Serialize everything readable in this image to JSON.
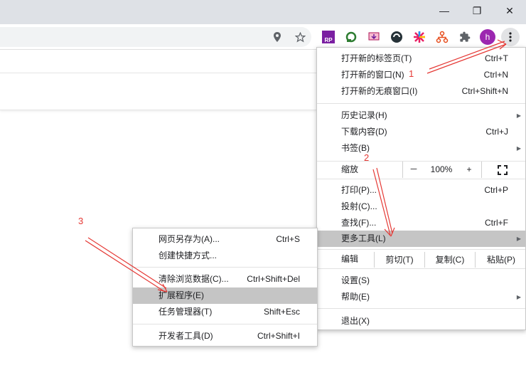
{
  "window_controls": {
    "minimize": "—",
    "restore": "❐",
    "close": "✕"
  },
  "toolbar": {
    "profile_initial": "h",
    "ext_rp_label": "RP",
    "accent_purple": "#9c27b0"
  },
  "main_menu": {
    "new_tab": "打开新的标签页(T)",
    "new_tab_sc": "Ctrl+T",
    "new_window": "打开新的窗口(N)",
    "new_window_sc": "Ctrl+N",
    "incognito": "打开新的无痕窗口(I)",
    "incognito_sc": "Ctrl+Shift+N",
    "history": "历史记录(H)",
    "downloads": "下载内容(D)",
    "downloads_sc": "Ctrl+J",
    "bookmarks": "书签(B)",
    "zoom": "缩放",
    "zoom_minus": "－",
    "zoom_value": "100%",
    "zoom_plus": "+",
    "print": "打印(P)...",
    "print_sc": "Ctrl+P",
    "cast": "投射(C)...",
    "find": "查找(F)...",
    "find_sc": "Ctrl+F",
    "more_tools": "更多工具(L)",
    "edit": "编辑",
    "cut": "剪切(T)",
    "copy": "复制(C)",
    "paste": "粘贴(P)",
    "settings": "设置(S)",
    "help": "帮助(E)",
    "exit": "退出(X)"
  },
  "sub_menu": {
    "save_as": "网页另存为(A)...",
    "save_as_sc": "Ctrl+S",
    "create_shortcut": "创建快捷方式...",
    "clear_data": "清除浏览数据(C)...",
    "clear_data_sc": "Ctrl+Shift+Del",
    "extensions": "扩展程序(E)",
    "task_manager": "任务管理器(T)",
    "task_manager_sc": "Shift+Esc",
    "dev_tools": "开发者工具(D)",
    "dev_tools_sc": "Ctrl+Shift+I"
  },
  "annotations": {
    "one": "1",
    "two": "2",
    "three": "3",
    "color": "#e53935"
  }
}
